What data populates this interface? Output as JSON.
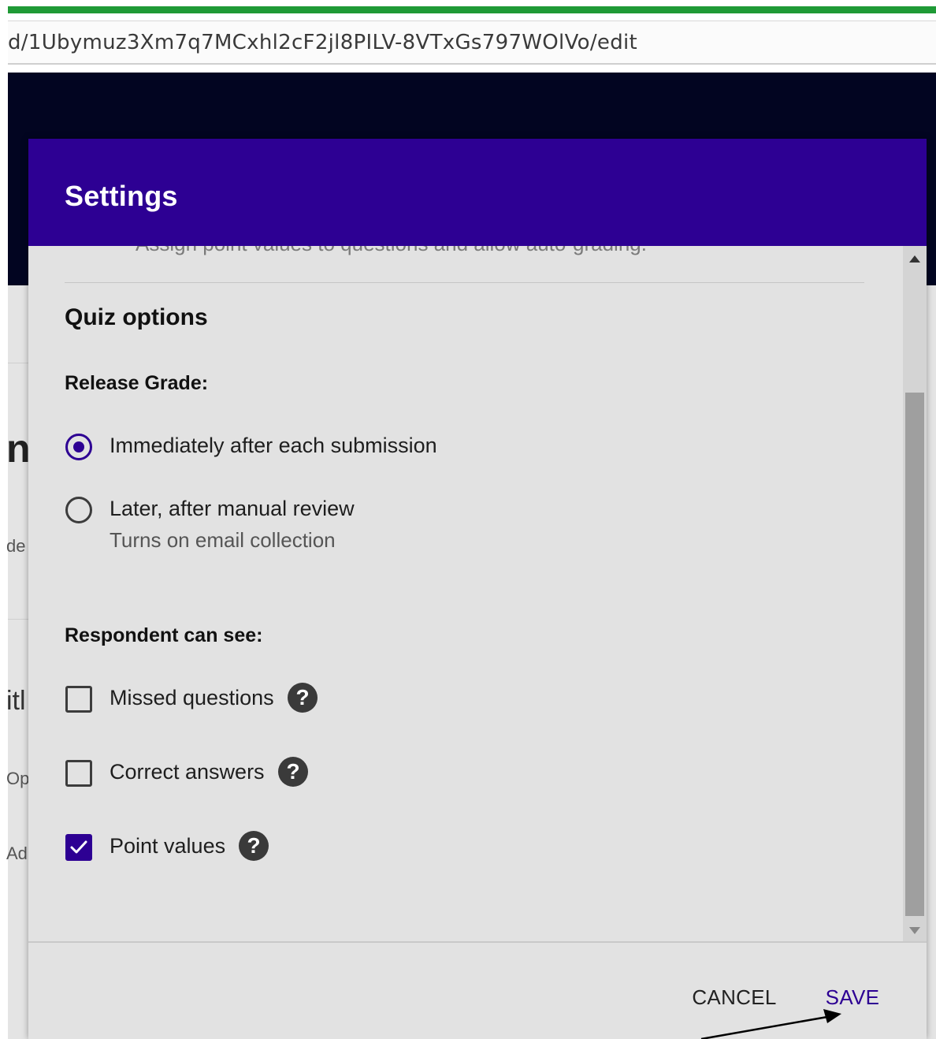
{
  "browser": {
    "url": "d/1Ubymuz3Xm7q7MCxhl2cF2jl8PILV-8VTxGs797WOlVo/edit",
    "accent_color": "#1f9a36"
  },
  "background_page": {
    "fragments": [
      "nt",
      "de",
      "itl",
      "Op",
      "Ad"
    ]
  },
  "dialog": {
    "title": "Settings",
    "header_color": "#2d0093",
    "cut_off_description": "Assign point values to questions and allow auto-grading.",
    "quiz_options": {
      "title": "Quiz options",
      "release_grade": {
        "label": "Release Grade:",
        "options": [
          {
            "label": "Immediately after each submission",
            "selected": true
          },
          {
            "label": "Later, after manual review",
            "sublabel": "Turns on email collection",
            "selected": false
          }
        ]
      },
      "respondent_can_see": {
        "label": "Respondent can see:",
        "options": [
          {
            "label": "Missed questions",
            "checked": false,
            "help_icon": "?"
          },
          {
            "label": "Correct answers",
            "checked": false,
            "help_icon": "?"
          },
          {
            "label": "Point values",
            "checked": true,
            "help_icon": "?"
          }
        ]
      }
    },
    "footer": {
      "cancel_label": "CANCEL",
      "save_label": "SAVE"
    }
  },
  "annotation": {
    "icon": "arrow-pointer",
    "target": "save-button"
  }
}
